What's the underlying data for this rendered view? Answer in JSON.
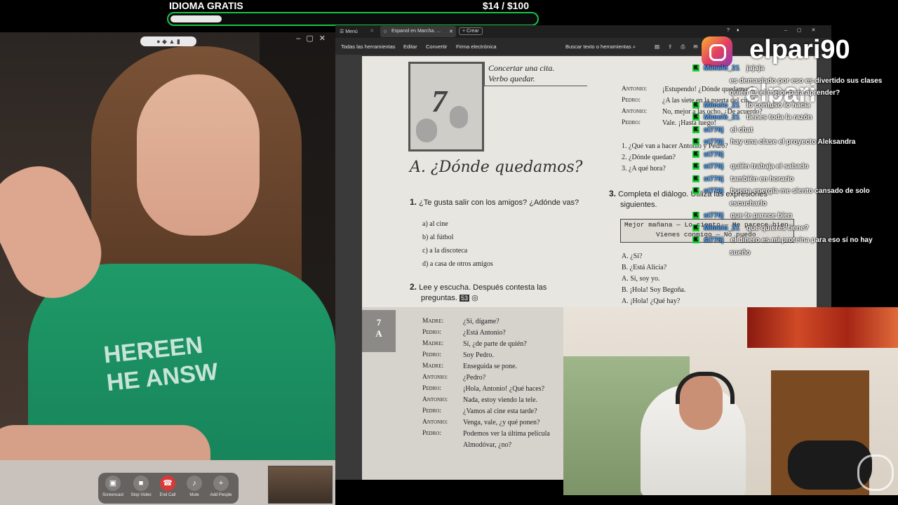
{
  "goal": {
    "title": "IDIOMA GRATIS",
    "amount": "$14   / $100",
    "progress": 0.14
  },
  "call": {
    "controls": [
      {
        "label": "Screencast",
        "icon": "screencast-icon"
      },
      {
        "label": "Stop Video",
        "icon": "video-icon"
      },
      {
        "label": "End Call",
        "icon": "end-call-icon"
      },
      {
        "label": "Mute",
        "icon": "microphone-icon"
      },
      {
        "label": "Add People",
        "icon": "add-people-icon"
      }
    ],
    "shirt_text": "HEREEN\nHE ANSW"
  },
  "pdf": {
    "tab": {
      "menu": "Menú",
      "title": "Espanol en Marcha. ...",
      "create": "Crear"
    },
    "toolbar": {
      "all_tools": "Todas las herramientas",
      "edit": "Editar",
      "convert": "Convertir",
      "sign": "Firma electrónica",
      "search": "Buscar texto o herramientas"
    },
    "page": {
      "unit_number": "7",
      "box_line1": "Concertar una cita.",
      "box_line2": "Verbo quedar.",
      "section_title": "A. ¿Dónde quedamos?",
      "q1": "¿Te gusta salir con los amigos? ¿Adónde vas?",
      "options": [
        "a) al cine",
        "b) al fútbol",
        "c) a la discoteca",
        "d) a casa de otros amigos"
      ],
      "q2": "Lee y escucha. Después contesta las",
      "q2b": "preguntas.",
      "audio_track": "53",
      "side_tab": "7\nA",
      "dialogue": [
        {
          "speaker": "Madre:",
          "line": "¿Sí, dígame?"
        },
        {
          "speaker": "Pedro:",
          "line": "¿Está Antonio?"
        },
        {
          "speaker": "Madre:",
          "line": "Sí, ¿de parte de quién?"
        },
        {
          "speaker": "Pedro:",
          "line": "Soy Pedro."
        },
        {
          "speaker": "Madre:",
          "line": "Enseguida se pone."
        },
        {
          "speaker": "Antonio:",
          "line": "¿Pedro?"
        },
        {
          "speaker": "Pedro:",
          "line": "¡Hola, Antonio! ¿Qué haces?"
        },
        {
          "speaker": "Antonio:",
          "line": "Nada, estoy viendo la tele."
        },
        {
          "speaker": "Pedro:",
          "line": "¿Vamos al cine esta tarde?"
        },
        {
          "speaker": "Antonio:",
          "line": "Venga, vale, ¿y qué ponen?"
        },
        {
          "speaker": "Pedro:",
          "line": "Podemos ver la última película"
        },
        {
          "speaker": "",
          "line": "Almodóvar, ¿no?"
        }
      ],
      "right_dialogue": [
        {
          "speaker": "Antonio:",
          "line": "¡Estupendo! ¿Dónde quedamos?"
        },
        {
          "speaker": "Pedro:",
          "line": "¿A las siete en la puerta del cine?"
        },
        {
          "speaker": "Antonio:",
          "line": "No, mejor a las ocho. ¿De acuerdo?"
        },
        {
          "speaker": "Pedro:",
          "line": "Vale. ¡Hasta luego!"
        }
      ],
      "right_questions": [
        "1. ¿Qué van a hacer Antonio y Pedro?",
        "2. ¿Dónde quedan?",
        "3. ¿A qué hora?"
      ],
      "q3": "Completa el diálogo. Utiliza las expresiones",
      "q3b": "siguientes.",
      "box3_line1": "Mejor mañana — Lo siento — Me parece bien",
      "box3_line2": "Vienes conmigo — No puedo",
      "right_dialogue2": [
        "A. ¿Sí?",
        "B. ¿Está Alicia?",
        "A. Sí, soy yo.",
        "B. ¡Hola! Soy Begoña.",
        "A. ¡Hola! ¿Qué hay?"
      ]
    }
  },
  "chat": [
    {
      "user": "Mimelo_21",
      "msg": "jajaja"
    },
    {
      "user": "",
      "msg": "es demasiado por eso es divertido sus clases"
    },
    {
      "user": "",
      "msg": "quién es el mejor para aprender?"
    },
    {
      "user": "Mimelo_21",
      "msg": "lo confuso lo hacía"
    },
    {
      "user": "Mimelo_21",
      "msg": "tienes toda la razón"
    },
    {
      "user": "st776j",
      "msg": "el chat"
    },
    {
      "user": "st776j",
      "msg": "hay una clase el proyecto Aleksandra"
    },
    {
      "user": "st776j",
      "msg": ""
    },
    {
      "user": "st776j",
      "msg": "quién trabaja el sabado"
    },
    {
      "user": "st776j",
      "msg": "también en horario"
    },
    {
      "user": "st776j",
      "msg": "buena energía me siento cansado de solo"
    },
    {
      "user": "",
      "msg": "escucharlo"
    },
    {
      "user": "st776j",
      "msg": "que te parece bien"
    },
    {
      "user": "Mimelo_21",
      "msg": "que quieres tiene?"
    },
    {
      "user": "st776j",
      "msg": "el dinero es mi proteína para eso sí no hay"
    },
    {
      "user": "",
      "msg": "sueño"
    }
  ],
  "watermark": {
    "handle": "elpari90",
    "handle2": "elpari"
  },
  "colors": {
    "goal_border": "#19c24a",
    "chat_badge": "#1fd93a",
    "username": "#4aa3ff"
  }
}
